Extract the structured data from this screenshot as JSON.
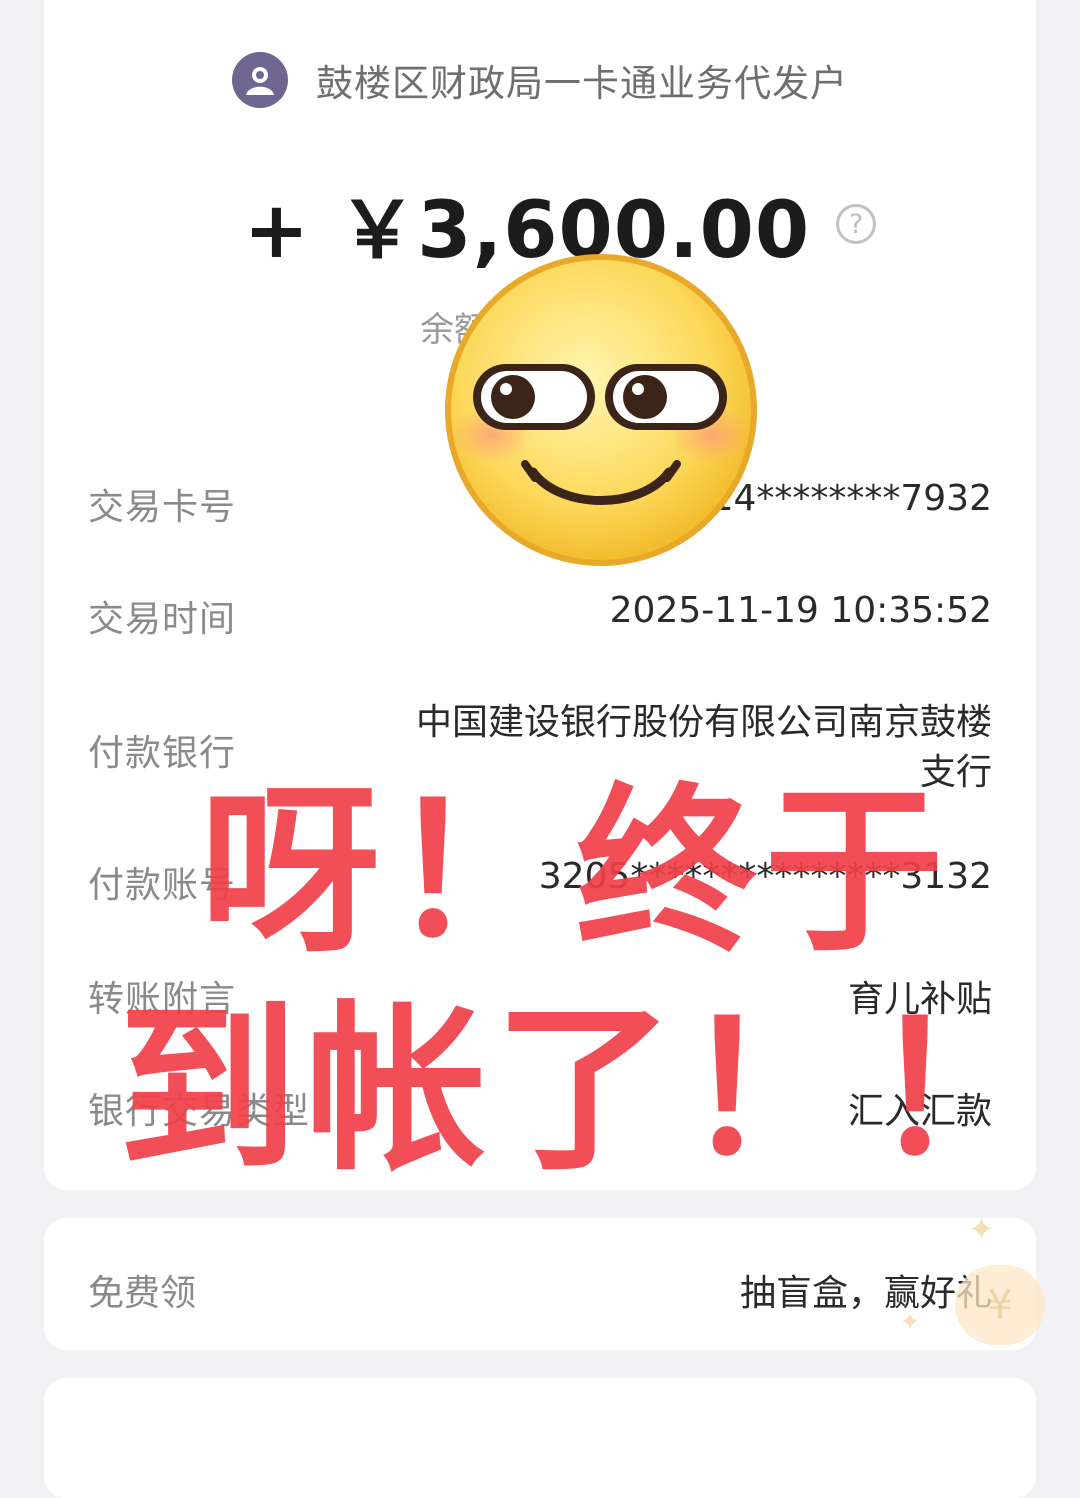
{
  "header": {
    "payer_name": "鼓楼区财政局一卡通业务代发户",
    "amount": "+ ￥3,600.00",
    "help_icon_glyph": "?",
    "balance_label_partial": "余额"
  },
  "details": [
    {
      "label": "交易卡号",
      "value": "14********7932"
    },
    {
      "label": "交易时间",
      "value": "2025-11-19 10:35:52"
    },
    {
      "label": "付款银行",
      "value": "中国建设银行股份有限公司南京鼓楼支行"
    },
    {
      "label": "付款账号",
      "value": "3205***************3132"
    },
    {
      "label": "转账附言",
      "value": "育儿补贴"
    },
    {
      "label": "银行交易类型",
      "value": "汇入汇款"
    }
  ],
  "overlay": {
    "line1": "呀！终于",
    "line2": "到帐了！！",
    "color": "#f0404a"
  },
  "promo": {
    "label": "免费领",
    "value": "抽盲盒，赢好礼",
    "coin_glyph": "¥"
  },
  "icons": {
    "avatar": "user-avatar-icon",
    "help": "question-circle-icon",
    "emoji": "smirk-emoji-sticker"
  }
}
